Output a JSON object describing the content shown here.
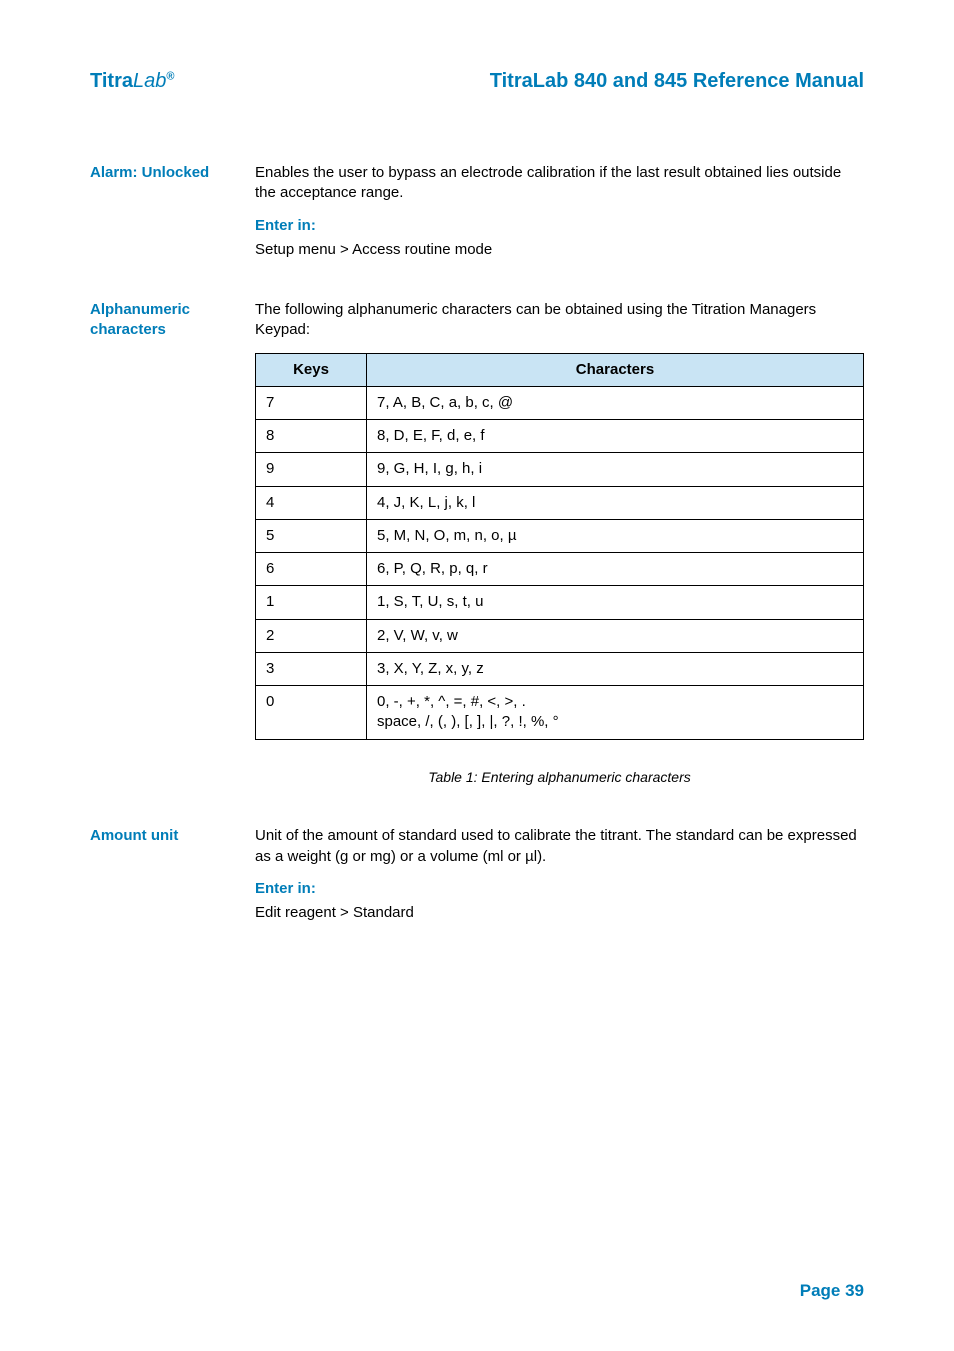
{
  "header": {
    "brand_prefix": "Titra",
    "brand_em": "Lab",
    "brand_sup": "®",
    "doc_title": "TitraLab 840 and 845 Reference Manual"
  },
  "sections": {
    "alarm": {
      "label": "Alarm: Unlocked",
      "body": "Enables the user to bypass an electrode calibration if the last result obtained lies outside the acceptance range.",
      "enter_in_heading": "Enter in:",
      "enter_in_path": "Setup menu > Access routine mode"
    },
    "alphanumeric": {
      "label": "Alphanumeric characters",
      "intro": "The following alphanumeric characters can be obtained using the Titration Managers Keypad:",
      "table": {
        "head_keys": "Keys",
        "head_chars": "Characters",
        "rows": [
          {
            "key": "7",
            "chars": "7, A, B, C, a, b, c, @"
          },
          {
            "key": "8",
            "chars": "8, D, E, F, d, e, f"
          },
          {
            "key": "9",
            "chars": "9, G, H, I, g, h, i"
          },
          {
            "key": "4",
            "chars": "4, J, K, L, j, k, l"
          },
          {
            "key": "5",
            "chars": "5, M, N, O, m, n, o, µ"
          },
          {
            "key": "6",
            "chars": "6, P, Q, R, p, q, r"
          },
          {
            "key": "1",
            "chars": "1, S, T, U, s, t, u"
          },
          {
            "key": "2",
            "chars": "2, V, W, v, w"
          },
          {
            "key": "3",
            "chars": "3, X, Y, Z, x, y, z"
          },
          {
            "key": "0",
            "chars": "0, -, +, *, ^, =, #, <, >, .\nspace, /, (, ), [, ], |, ?, !, %, °"
          }
        ],
        "caption": "Table 1: Entering alphanumeric characters"
      }
    },
    "amount": {
      "label": "Amount unit",
      "body": "Unit of the amount of standard used to calibrate the titrant. The standard can be expressed as a weight (g or mg) or a volume (ml or µl).",
      "enter_in_heading": "Enter in:",
      "enter_in_path": "Edit reagent > Standard"
    }
  },
  "page_number": "Page 39"
}
